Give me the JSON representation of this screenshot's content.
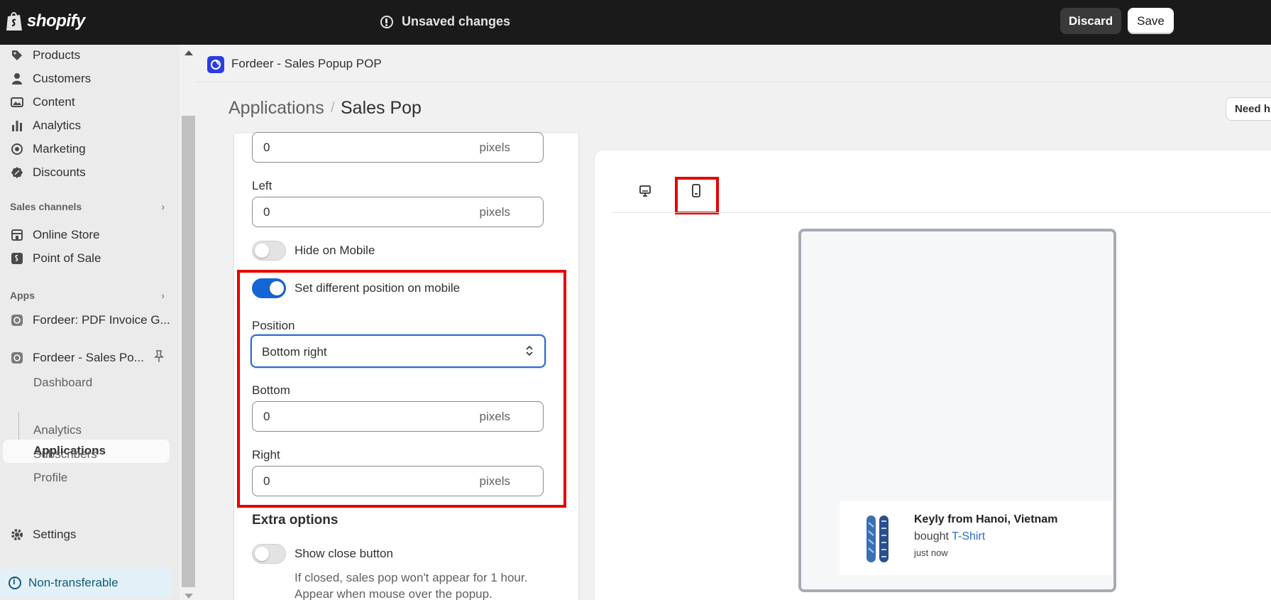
{
  "topbar": {
    "logo_text": "shopify",
    "status": "Unsaved changes",
    "discard_label": "Discard",
    "save_label": "Save"
  },
  "sidebar": {
    "items": [
      {
        "label": "Products",
        "icon": "tag-icon"
      },
      {
        "label": "Customers",
        "icon": "person-icon"
      },
      {
        "label": "Content",
        "icon": "image-icon"
      },
      {
        "label": "Analytics",
        "icon": "bar-chart-icon"
      },
      {
        "label": "Marketing",
        "icon": "target-icon"
      },
      {
        "label": "Discounts",
        "icon": "discount-icon"
      }
    ],
    "sales_channels_heading": "Sales channels",
    "channels": [
      {
        "label": "Online Store",
        "icon": "store-icon"
      },
      {
        "label": "Point of Sale",
        "icon": "pos-icon"
      }
    ],
    "apps_heading": "Apps",
    "apps": [
      {
        "label": "Fordeer: PDF Invoice G..."
      },
      {
        "label": "Fordeer - Sales Po..."
      }
    ],
    "app_subitems": [
      "Dashboard",
      "Applications",
      "Analytics",
      "Subscribers",
      "Profile"
    ],
    "settings_label": "Settings",
    "nontransferable_label": "Non-transferable"
  },
  "app_header": {
    "name": "Fordeer - Sales Popup POP"
  },
  "breadcrumb": {
    "parent": "Applications",
    "separator": "/",
    "current": "Sales Pop",
    "help_button": "Need h"
  },
  "form": {
    "top_field": {
      "value": "0",
      "suffix": "pixels"
    },
    "left_label": "Left",
    "left_field": {
      "value": "0",
      "suffix": "pixels"
    },
    "hide_mobile_label": "Hide on Mobile",
    "hide_mobile_on": false,
    "diff_position_label": "Set different position on mobile",
    "diff_position_on": true,
    "position_label": "Position",
    "position_value": "Bottom right",
    "bottom_label": "Bottom",
    "bottom_field": {
      "value": "0",
      "suffix": "pixels"
    },
    "right_label": "Right",
    "right_field": {
      "value": "0",
      "suffix": "pixels"
    },
    "extra_heading": "Extra options",
    "close_button_label": "Show close button",
    "close_button_on": false,
    "close_help_1": "If closed, sales pop won't appear for 1 hour.",
    "close_help_2": "Appear when mouse over the popup."
  },
  "preview": {
    "devices": [
      "desktop-icon",
      "mobile-icon"
    ],
    "selected_device": "mobile",
    "popup": {
      "name": "Keyly from Hanoi, Vietnam",
      "bought_prefix": "bought",
      "product": "T-Shirt",
      "time": "just now"
    }
  },
  "colors": {
    "accent": "#1565d8",
    "highlight": "#e50000",
    "topbar": "#1a1a1a"
  }
}
